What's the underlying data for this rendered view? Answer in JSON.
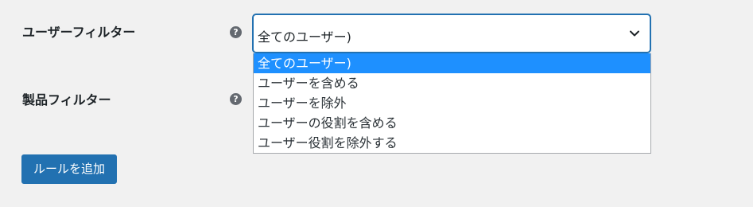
{
  "rules": {
    "user_filter": {
      "label": "ユーザーフィルター",
      "help_icon": "?",
      "selected_value": "全てのユーザー)",
      "options": [
        "全てのユーザー)",
        "ユーザーを含める",
        "ユーザーを除外",
        "ユーザーの役割を含める",
        "ユーザー役割を除外する"
      ],
      "selected_index": 0
    },
    "product_filter": {
      "label": "製品フィルター",
      "help_icon": "?"
    }
  },
  "add_rule_button": {
    "label": "ルールを追加"
  },
  "colors": {
    "background": "#f1f1f1",
    "accent": "#2271b1",
    "option_highlight": "#1e90ff",
    "help_icon": "#646970"
  },
  "icons": {
    "help": "question-circle-icon",
    "dropdown": "chevron-down-icon"
  }
}
